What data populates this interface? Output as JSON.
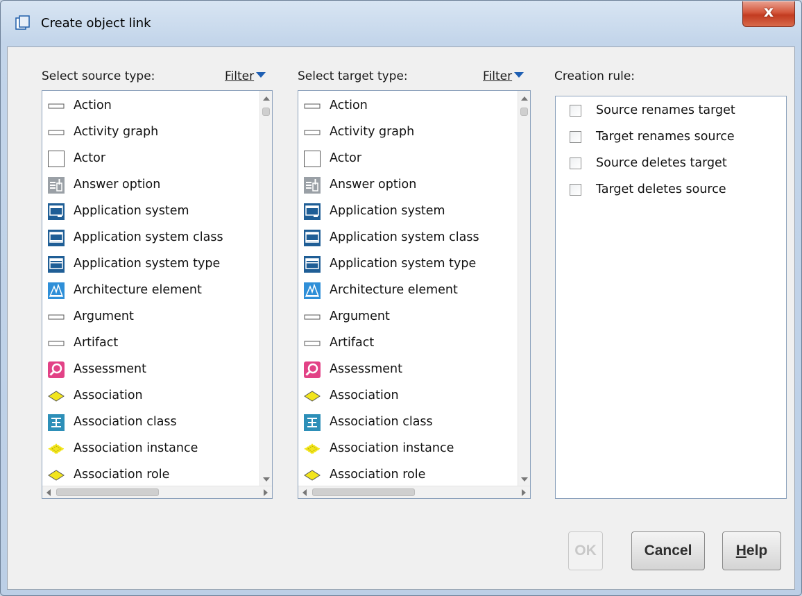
{
  "window": {
    "title": "Create object link",
    "close_label": "x"
  },
  "source": {
    "label": "Select source type:",
    "filter_label": "Filter",
    "items": [
      {
        "label": "Action",
        "icon": "rect-outline-icon"
      },
      {
        "label": "Activity graph",
        "icon": "rect-outline-icon"
      },
      {
        "label": "Actor",
        "icon": "square-outline-icon"
      },
      {
        "label": "Answer option",
        "icon": "answer-option-icon"
      },
      {
        "label": "Application system",
        "icon": "application-system-icon"
      },
      {
        "label": "Application system class",
        "icon": "application-system-class-icon"
      },
      {
        "label": "Application system type",
        "icon": "application-system-type-icon"
      },
      {
        "label": "Architecture element",
        "icon": "architecture-element-icon"
      },
      {
        "label": "Argument",
        "icon": "rect-outline-icon"
      },
      {
        "label": "Artifact",
        "icon": "rect-outline-icon"
      },
      {
        "label": "Assessment",
        "icon": "assessment-icon"
      },
      {
        "label": "Association",
        "icon": "association-diamond-icon"
      },
      {
        "label": "Association class",
        "icon": "association-class-icon"
      },
      {
        "label": "Association instance",
        "icon": "association-instance-icon"
      },
      {
        "label": "Association role",
        "icon": "association-diamond-icon"
      }
    ]
  },
  "target": {
    "label": "Select target type:",
    "filter_label": "Filter",
    "items": [
      {
        "label": "Action",
        "icon": "rect-outline-icon"
      },
      {
        "label": "Activity graph",
        "icon": "rect-outline-icon"
      },
      {
        "label": "Actor",
        "icon": "square-outline-icon"
      },
      {
        "label": "Answer option",
        "icon": "answer-option-icon"
      },
      {
        "label": "Application system",
        "icon": "application-system-icon"
      },
      {
        "label": "Application system class",
        "icon": "application-system-class-icon"
      },
      {
        "label": "Application system type",
        "icon": "application-system-type-icon"
      },
      {
        "label": "Architecture element",
        "icon": "architecture-element-icon"
      },
      {
        "label": "Argument",
        "icon": "rect-outline-icon"
      },
      {
        "label": "Artifact",
        "icon": "rect-outline-icon"
      },
      {
        "label": "Assessment",
        "icon": "assessment-icon"
      },
      {
        "label": "Association",
        "icon": "association-diamond-icon"
      },
      {
        "label": "Association class",
        "icon": "association-class-icon"
      },
      {
        "label": "Association instance",
        "icon": "association-instance-icon"
      },
      {
        "label": "Association role",
        "icon": "association-diamond-icon"
      }
    ]
  },
  "creation": {
    "label": "Creation rule:",
    "rules": [
      {
        "label": "Source renames target",
        "checked": false
      },
      {
        "label": "Target renames source",
        "checked": false
      },
      {
        "label": "Source deletes target",
        "checked": false
      },
      {
        "label": "Target deletes source",
        "checked": false
      }
    ]
  },
  "buttons": {
    "ok": "OK",
    "cancel": "Cancel",
    "help_first": "H",
    "help_rest": "elp"
  }
}
